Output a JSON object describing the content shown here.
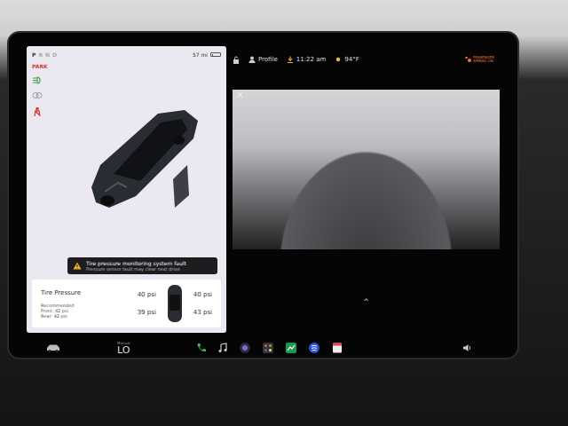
{
  "top_bar": {
    "profile": "Profile",
    "time": "11:22 am",
    "temperature": "94°F",
    "airbag": "PASSENGER AIRBAG ON"
  },
  "gear_selector": [
    {
      "label": "P",
      "selected": true
    },
    {
      "label": "R",
      "selected": false
    },
    {
      "label": "N",
      "selected": false
    },
    {
      "label": "D",
      "selected": false
    }
  ],
  "range": "57 mi",
  "battery_level": 0.2,
  "park_label": "PARK",
  "alert": {
    "title": "Tire pressure monitoring system fault",
    "detail": "Pressure sensor fault may clear next drive"
  },
  "tire_pressure": {
    "title": "Tire Pressure",
    "recommended_label": "Recommended",
    "front": "Front: 42 psi",
    "rear": "Rear: 42 psi",
    "tires": [
      {
        "position": "front-left",
        "reading": "40 psi"
      },
      {
        "position": "front-right",
        "reading": "40 psi"
      },
      {
        "position": "rear-left",
        "reading": "39 psi"
      },
      {
        "position": "rear-right",
        "reading": "43 psi"
      }
    ]
  },
  "camera": {
    "close": "×",
    "expand": "^"
  },
  "dock": {
    "fan_mode": "Manual",
    "fan_level": "LO"
  }
}
